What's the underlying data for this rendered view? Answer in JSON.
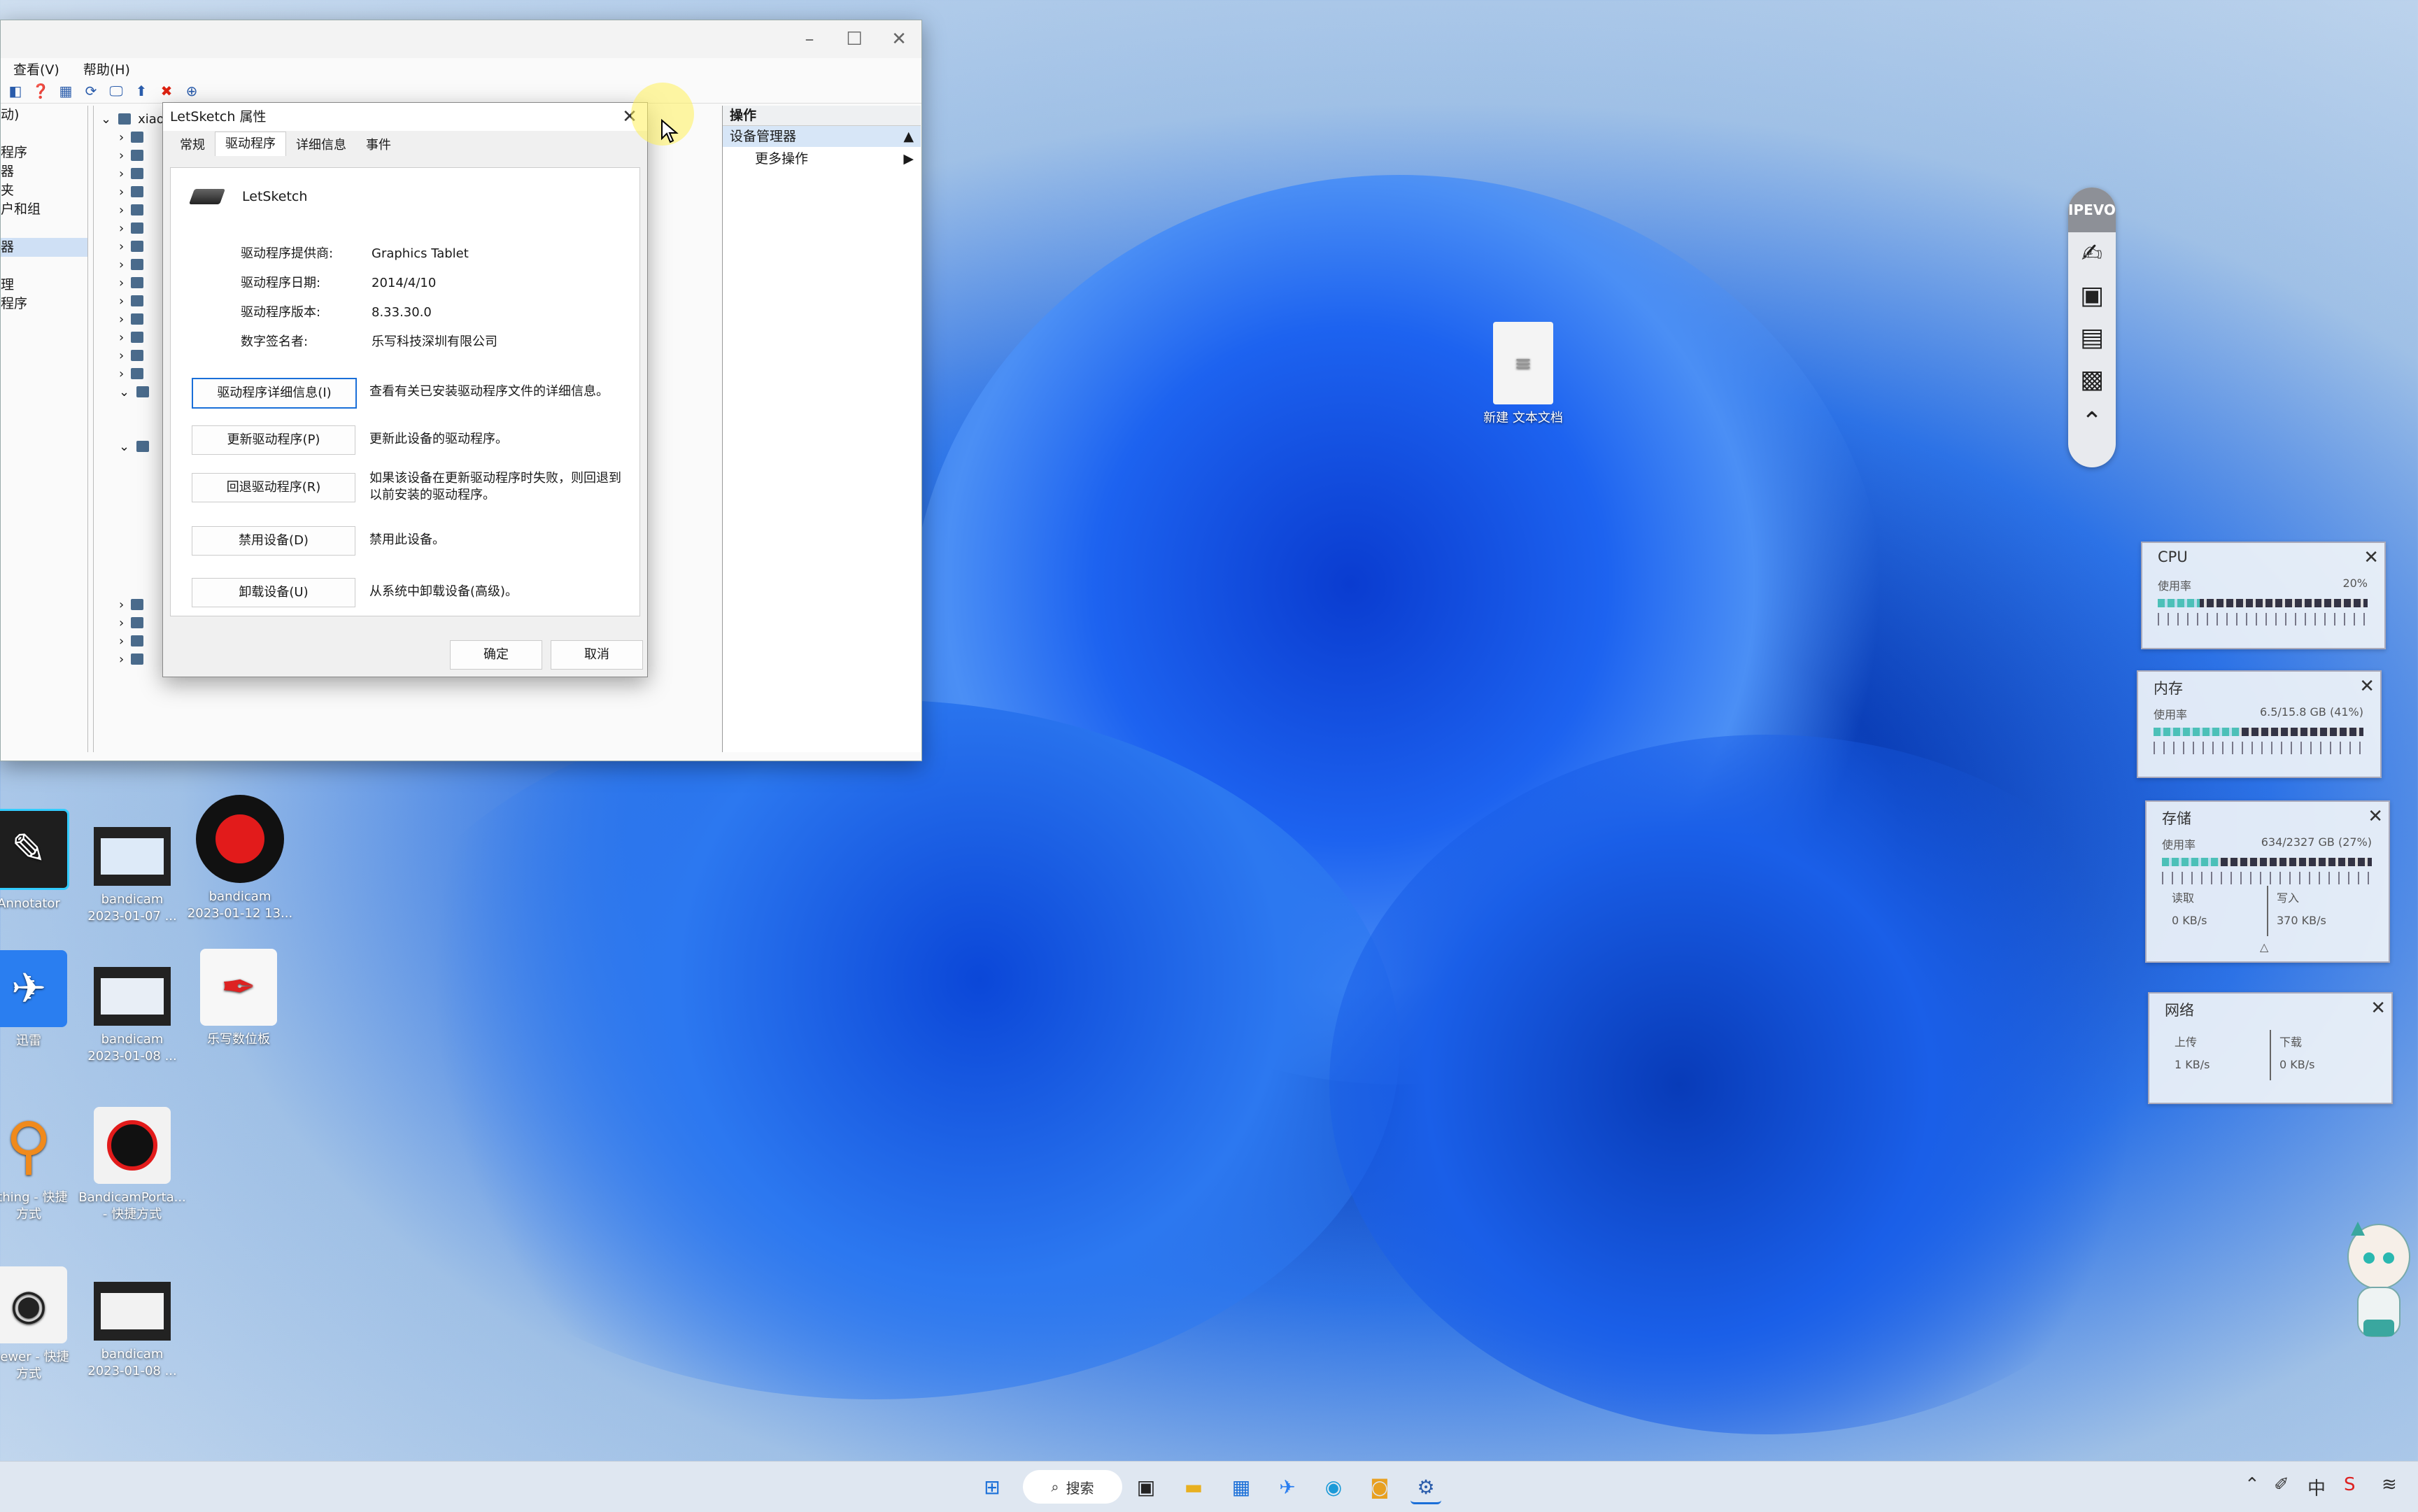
{
  "mmc": {
    "menu": [
      "查看(V)",
      "帮助(H)"
    ],
    "left_items": [
      "动)",
      "",
      "程序",
      "器",
      "夹",
      "户和组",
      "",
      "器",
      "",
      "理",
      "程序"
    ],
    "tree_root": "xiao",
    "actions": {
      "header": "操作",
      "selected": "设备管理器",
      "more": "更多操作"
    }
  },
  "dialog": {
    "title": "LetSketch 属性",
    "tabs": [
      "常规",
      "驱动程序",
      "详细信息",
      "事件"
    ],
    "active_tab": "驱动程序",
    "device_name": "LetSketch",
    "fields": [
      {
        "k": "驱动程序提供商:",
        "v": "Graphics Tablet"
      },
      {
        "k": "驱动程序日期:",
        "v": "2014/4/10"
      },
      {
        "k": "驱动程序版本:",
        "v": "8.33.30.0"
      },
      {
        "k": "数字签名者:",
        "v": "乐写科技深圳有限公司"
      }
    ],
    "buttons": [
      {
        "label": "驱动程序详细信息(I)",
        "desc": "查看有关已安装驱动程序文件的详细信息。"
      },
      {
        "label": "更新驱动程序(P)",
        "desc": "更新此设备的驱动程序。"
      },
      {
        "label": "回退驱动程序(R)",
        "desc": "如果该设备在更新驱动程序时失败，则回退到以前安装的驱动程序。"
      },
      {
        "label": "禁用设备(D)",
        "desc": "禁用此设备。"
      },
      {
        "label": "卸载设备(U)",
        "desc": "从系统中卸载设备(高级)。"
      }
    ],
    "ok": "确定",
    "cancel": "取消"
  },
  "desktop_icons": [
    {
      "name": "新建 文本文档",
      "lines": [
        "新建 文本文档"
      ]
    },
    {
      "lines": [
        "Annotator"
      ]
    },
    {
      "lines": [
        "bandicam",
        "2023-01-07 ..."
      ]
    },
    {
      "lines": [
        "bandicam",
        "2023-01-12 13..."
      ]
    },
    {
      "lines": [
        "迅雷"
      ]
    },
    {
      "lines": [
        "bandicam",
        "2023-01-08 ..."
      ]
    },
    {
      "lines": [
        "乐写数位板"
      ]
    },
    {
      "lines": [
        "ything - 快捷",
        "方式"
      ]
    },
    {
      "lines": [
        "BandicamPorta...",
        "- 快捷方式"
      ]
    },
    {
      "lines": [
        "Viewer - 快捷",
        "方式"
      ]
    },
    {
      "lines": [
        "bandicam",
        "2023-01-08 ..."
      ]
    }
  ],
  "ipevo": {
    "logo": "IPEVO"
  },
  "monitors": {
    "cpu": {
      "title": "CPU",
      "label": "使用率",
      "value": "20%",
      "fraction": 0.2
    },
    "mem": {
      "title": "内存",
      "label": "使用率",
      "value": "6.5/15.8 GB (41%)",
      "fraction": 0.41
    },
    "disk": {
      "title": "存储",
      "label": "使用率",
      "value": "634/2327 GB (27%)",
      "fraction": 0.27,
      "read_label": "读取",
      "read": "0 KB/s",
      "write_label": "写入",
      "write": "370 KB/s"
    },
    "net": {
      "title": "网络",
      "up_label": "上传",
      "up": "1 KB/s",
      "down_label": "下载",
      "down": "0 KB/s"
    }
  },
  "taskbar": {
    "search": "搜索"
  },
  "colors": {
    "accent": "#1a6fd8",
    "taskbar": "#dfe7f1"
  }
}
